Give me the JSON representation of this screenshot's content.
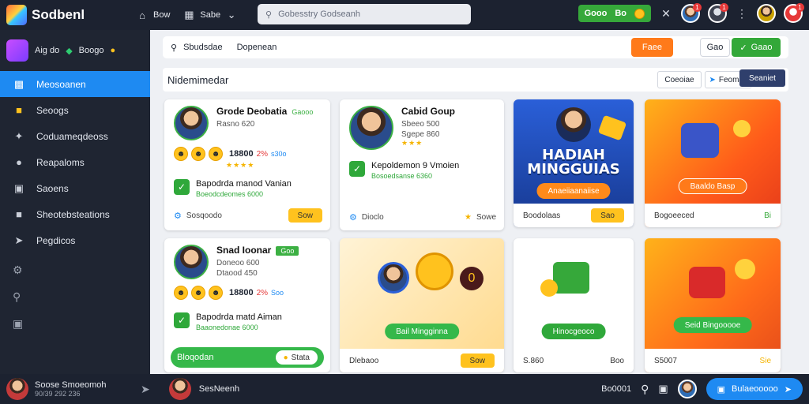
{
  "topbar": {
    "app_title": "Sodbenl",
    "nav": [
      {
        "icon": "home-icon",
        "label": "Bow"
      },
      {
        "icon": "bookmark-icon",
        "label": "Sabe"
      }
    ],
    "search_placeholder": "Gobesstry Godseanh",
    "wallet_left": "Gooo",
    "wallet_right": "Bo",
    "notification_badge_1": "1",
    "notification_badge_2": "1",
    "notification_badge_3": "1"
  },
  "sidebar": {
    "header_label": "Aig do",
    "header_gem_label": "Boogo",
    "items": [
      {
        "icon": "monitor-icon",
        "label": "Meosoanen",
        "active": true
      },
      {
        "icon": "folder-icon",
        "label": "Seoogs"
      },
      {
        "icon": "puzzle-icon",
        "label": "Coduameqdeoss"
      },
      {
        "icon": "circle-icon",
        "label": "Reapaloms"
      },
      {
        "icon": "bag-icon",
        "label": "Saoens"
      },
      {
        "icon": "folder-icon",
        "label": "Sheotebsteations"
      },
      {
        "icon": "pin-icon",
        "label": "Pegdicos"
      }
    ]
  },
  "main": {
    "search_prefix": "Sbudsdae",
    "search_value": "Dopenean",
    "btn_orange": "Faee",
    "btn_white": "Gao",
    "btn_green": "Gaao",
    "section_title": "Nidemimedar",
    "tab_a": "Coeoiae",
    "tab_b": "Feomae",
    "tab_c": "Seaniet",
    "cards": {
      "c1": {
        "name": "Grode Deobatia",
        "tag": "Gaooo",
        "sub": "Rasno 620",
        "num": "18800",
        "pct": "2%",
        "note": "s30o",
        "task_title": "Bapodrda manod Vanian",
        "task_sub": "Boeodcdeomes 6000",
        "foot_left": "Sosqoodo",
        "foot_btn": "Sow"
      },
      "c2": {
        "name": "Cabid Goup",
        "sub": "Sbeeo 500",
        "sub2": "Sgepe 860",
        "task_title": "Kepoldemon 9 Vmoien",
        "task_sub": "Bosoedsanse 6360",
        "foot_left": "Dioclo",
        "foot_btn": "Sowe"
      },
      "c3": {
        "title": "HADIAH MINGGUIAS",
        "btn": "Anaeiiaanaiise",
        "foot_left": "Boodolaas",
        "foot_btn": "Sao"
      },
      "c4": {
        "btn": "Baaldo Basp",
        "foot_left": "Bogoeeced",
        "foot_btn": "Bi"
      },
      "c5": {
        "name": "Snad Ioonar",
        "tag": "Goo",
        "sub": "Doneoo 600",
        "sub2": "Dtaood 450",
        "num": "18800",
        "pct": "2%",
        "note": "Soo",
        "task_title": "Bapodrda matd Aiman",
        "task_sub": "Baaonedonae 6000",
        "bar_left": "Bloqodan",
        "bar_right": "Stata"
      },
      "c6": {
        "btn": "Bail Mingginna",
        "foot_left": "Dlebaoo",
        "foot_btn": "Sow"
      },
      "c7": {
        "btn": "Hinocgeoco",
        "foot_left": "S.860",
        "foot_btn": "Boo"
      },
      "c8": {
        "btn": "Seid Bingooooe",
        "foot_left": "S5007",
        "foot_btn": "Sie"
      }
    }
  },
  "bottombar": {
    "user_name": "Soose Smoeomoh",
    "user_sub": "90/39 292 236",
    "mid_label": "SesNeenh",
    "counter": "Bo0001",
    "btn": "Bulaeooooo"
  },
  "colors": {
    "accent_blue": "#1e8af2",
    "accent_green": "#36a83a",
    "accent_orange": "#ff7a1a",
    "dark_bg": "#1c2230"
  }
}
